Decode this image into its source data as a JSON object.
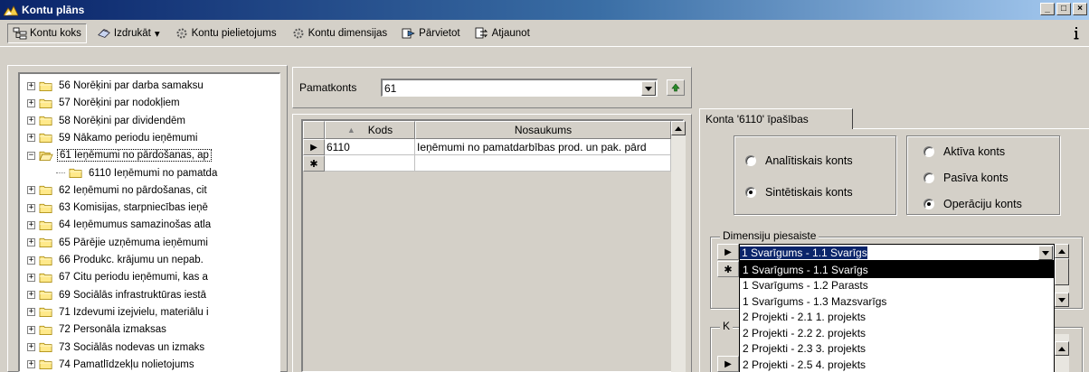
{
  "window": {
    "title": "Kontu plāns",
    "buttons": {
      "minimize": "_",
      "maximize": "□",
      "close": "×"
    }
  },
  "toolbar": {
    "items": [
      {
        "label": "Kontu koks",
        "icon": "tree-icon",
        "pressed": true
      },
      {
        "label": "Izdrukāt",
        "icon": "printer-icon",
        "dropdown": true
      },
      {
        "label": "Kontu pielietojums",
        "icon": "gears-icon"
      },
      {
        "label": "Kontu dimensijas",
        "icon": "gears-icon"
      },
      {
        "label": "Pārvietot",
        "icon": "move-icon"
      },
      {
        "label": "Atjaunot",
        "icon": "refresh-icon"
      }
    ],
    "dropdown_arrow": "▾",
    "info_icon": "info-icon"
  },
  "tree": {
    "items": [
      {
        "label": "56 Norēķini par darba samaksu",
        "level": 0,
        "expand": "+"
      },
      {
        "label": "57 Norēķini par nodokļiem",
        "level": 0,
        "expand": "+"
      },
      {
        "label": "58 Norēķini par dividendēm",
        "level": 0,
        "expand": "+"
      },
      {
        "label": "59 Nākamo periodu ieņēmumi",
        "level": 0,
        "expand": "+"
      },
      {
        "label": "61 Ieņēmumi no pārdošanas, ap",
        "level": 0,
        "expand": "−",
        "open": true,
        "selected": true
      },
      {
        "label": "6110 Ieņēmumi no pamatda",
        "level": 1
      },
      {
        "label": "62 Ieņēmumi no pārdošanas, cit",
        "level": 0,
        "expand": "+"
      },
      {
        "label": "63 Komisijas, starpniecības ieņē",
        "level": 0,
        "expand": "+"
      },
      {
        "label": "64 Ieņēmumus samazinošas atla",
        "level": 0,
        "expand": "+"
      },
      {
        "label": "65 Pārējie uzņēmuma ieņēmumi",
        "level": 0,
        "expand": "+"
      },
      {
        "label": "66 Produkc. krājumu un nepab.",
        "level": 0,
        "expand": "+"
      },
      {
        "label": "67 Citu periodu ieņēmumi, kas a",
        "level": 0,
        "expand": "+"
      },
      {
        "label": "69 Sociālās infrastruktūras iestā",
        "level": 0,
        "expand": "+"
      },
      {
        "label": "71 Izdevumi izejvielu, materiālu i",
        "level": 0,
        "expand": "+"
      },
      {
        "label": "72 Personāla izmaksas",
        "level": 0,
        "expand": "+"
      },
      {
        "label": "73 Sociālās nodevas un izmaks",
        "level": 0,
        "expand": "+"
      },
      {
        "label": "74 Pamatlīdzekļu nolietojums",
        "level": 0,
        "expand": "+"
      }
    ]
  },
  "pamatkonts": {
    "label": "Pamatkonts",
    "value": "61"
  },
  "grid": {
    "columns": [
      {
        "label": "Kods",
        "sort": "▲"
      },
      {
        "label": "Nosaukums"
      }
    ],
    "rows": [
      {
        "marker": "▶",
        "kods": "6110",
        "nosaukums": "Ieņēmumi no pamatdarbības prod. un pak. pārd"
      },
      {
        "marker": "✱",
        "kods": "",
        "nosaukums": ""
      }
    ]
  },
  "properties": {
    "tab_label": "Konta '6110' īpašības",
    "type_group": {
      "options": [
        {
          "label": "Analītiskais konts",
          "checked": false
        },
        {
          "label": "Sintētiskais konts",
          "checked": true
        }
      ]
    },
    "kind_group": {
      "options": [
        {
          "label": "Aktīva konts",
          "checked": false
        },
        {
          "label": "Pasīva konts",
          "checked": false
        },
        {
          "label": "Operāciju konts",
          "checked": true
        }
      ]
    },
    "dimensions": {
      "legend": "Dimensiju piesaiste",
      "selected": "1 Svarīgums - 1.1 Svarīgs",
      "row_markers": [
        "▶",
        "✱"
      ],
      "options": [
        "1 Svarīgums - 1.1 Svarīgs",
        "1 Svarīgums - 1.2 Parasts",
        "1 Svarīgums - 1.3 Mazsvarīgs",
        "2 Projekti - 2.1 1. projekts",
        "2 Projekti - 2.2 2. projekts",
        "2 Projekti - 2.3 3. projekts",
        "2 Projekti - 2.5 4. projekts"
      ],
      "second_legend_char": "K"
    }
  },
  "colors": {
    "title_start": "#0a246a",
    "title_end": "#a6caf0",
    "face": "#d4d0c8",
    "selection": "#000000"
  }
}
